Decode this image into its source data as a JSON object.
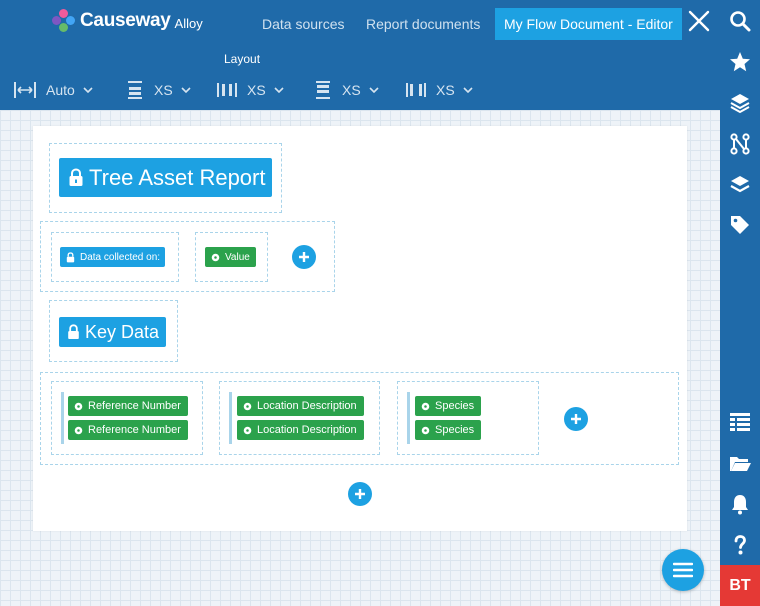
{
  "app": {
    "brand": "Causeway",
    "product": "Alloy"
  },
  "nav": {
    "data_sources": "Data sources",
    "report_documents": "Report documents",
    "active_document": "My Flow Document - Editor"
  },
  "toolbar": {
    "section_label": "Layout",
    "width": "Auto",
    "top_spacing": "XS",
    "horizontal_padding": "XS",
    "bottom_spacing": "XS",
    "column_gap": "XS"
  },
  "document": {
    "title": "Tree Asset Report",
    "data_collected_label": "Data collected on:",
    "value_field": "Value",
    "section_heading": "Key Data",
    "columns": [
      {
        "fields": [
          "Reference Number",
          "Reference Number"
        ]
      },
      {
        "fields": [
          "Location Description",
          "Location Description"
        ]
      },
      {
        "fields": [
          "Species",
          "Species"
        ]
      }
    ]
  },
  "user": {
    "initials": "BT"
  },
  "colors": {
    "header_bg": "#1f6aa9",
    "accent": "#1da1e2",
    "field_green": "#2ba24c",
    "avatar_red": "#e53935"
  },
  "icons": {
    "sidebar": [
      "search-icon",
      "star-icon",
      "layers-icon",
      "flow-icon",
      "stack-icon",
      "tag-icon",
      "table-icon",
      "folder-icon",
      "bell-icon",
      "help-icon"
    ]
  }
}
